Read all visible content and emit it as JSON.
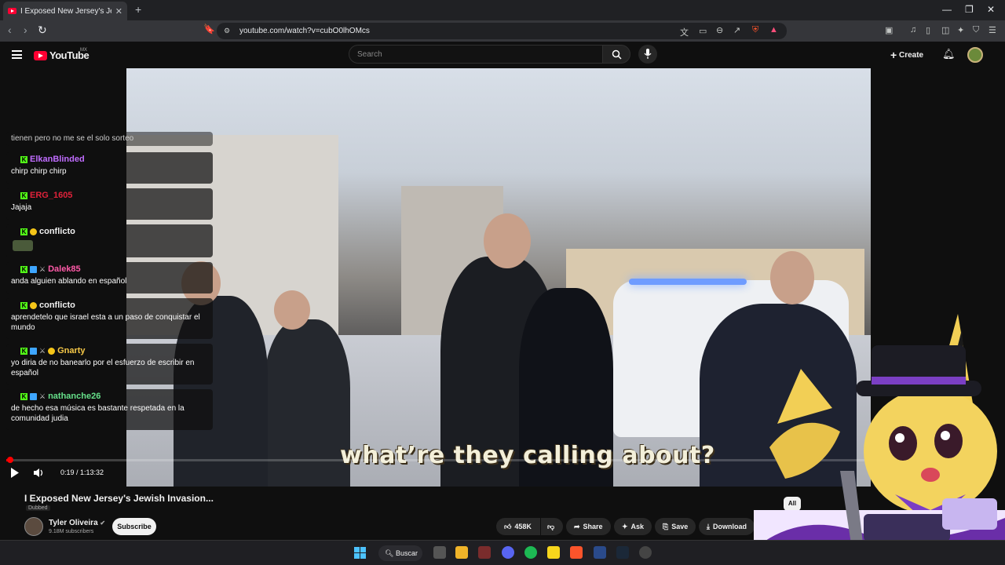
{
  "browser": {
    "tab_title": "I Exposed New Jersey's Jewish In",
    "tab_close": "✕",
    "new_tab": "+",
    "url": "youtube.com/watch?v=cubO0lhOMcs"
  },
  "header": {
    "logo_text": "YouTube",
    "country_code": "MX",
    "search_placeholder": "Search",
    "create_label": "Create"
  },
  "chat": [
    {
      "user": "",
      "text": "tienen pero no me se el solo sorteo",
      "color": "#9b8cff"
    },
    {
      "user": "ElkanBlinded",
      "text": "chirp chirp chirp",
      "color": "#c06cff"
    },
    {
      "user": "ERG_1605",
      "text": "Jajaja",
      "color": "#e0223a"
    },
    {
      "user": "conflicto",
      "text": "",
      "color": "#f1f1f1"
    },
    {
      "user": "Dalek85",
      "text": "anda alguien ablando en español",
      "color": "#ff5aa8"
    },
    {
      "user": "conflicto",
      "text": "aprendetelo que israel esta a un paso de conquistar el mundo",
      "color": "#f1f1f1"
    },
    {
      "user": "Gnarty",
      "text": "yo diria de no banearlo por el esfuerzo de escribir en español",
      "color": "#f7c948"
    },
    {
      "user": "nathanche26",
      "text": "de hecho esa música es bastante respetada en la comunidad judia",
      "color": "#66e08a"
    }
  ],
  "video": {
    "caption": "what’re they calling about?",
    "time": "0:19 / 1:13:32",
    "progress": 0.0043
  },
  "info": {
    "title": "I Exposed New Jersey's Jewish Invasion...",
    "dubbed": "Dubbed",
    "channel": "Tyler Oliveira",
    "subscribers": "9.18M subscribers",
    "subscribe_label": "Subscribe",
    "likes": "458K",
    "share_label": "Share",
    "ask_label": "Ask",
    "save_label": "Save",
    "download_label": "Download",
    "chip_all": "All"
  },
  "taskbar": {
    "search_label": "Buscar"
  }
}
